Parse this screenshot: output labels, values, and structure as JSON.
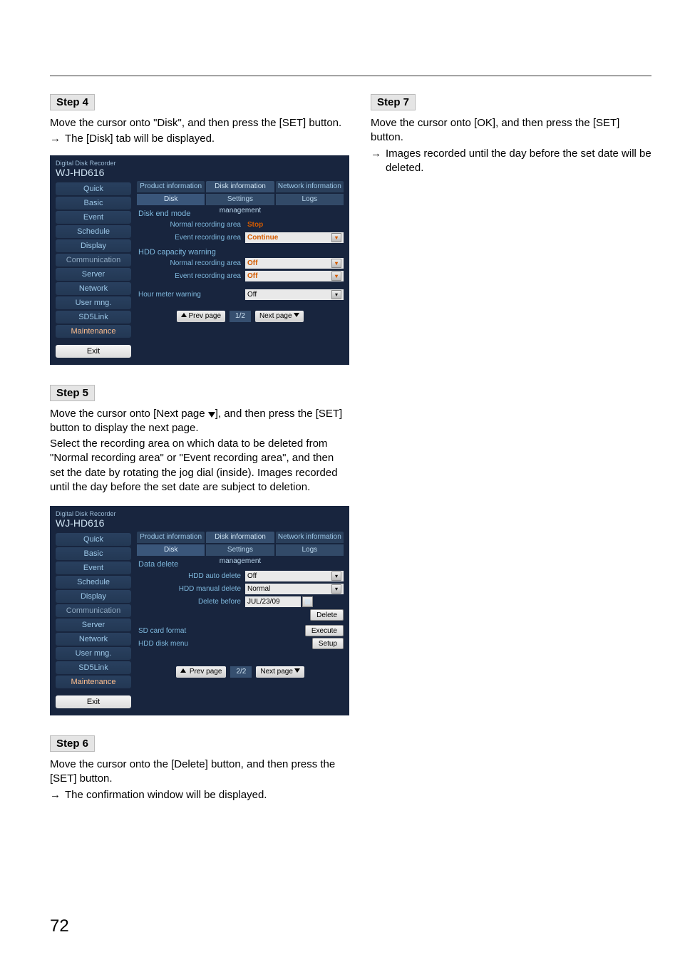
{
  "page_number": "72",
  "steps": {
    "s4": {
      "label": "Step 4",
      "text": "Move the cursor onto \"Disk\", and then press the [SET] button.",
      "arrow": "The [Disk] tab will be displayed."
    },
    "s5": {
      "label": "Step 5",
      "text1": "Move the cursor onto [Next page ",
      "text1b": "], and then press the [SET] button to display the next page.",
      "text2": "Select the recording area on which data to be deleted from \"Normal recording area\" or \"Event recording area\", and then set the date by rotating the jog dial (inside). Images recorded until the day before the set date are subject to deletion."
    },
    "s6": {
      "label": "Step 6",
      "text": "Move the cursor onto the [Delete] button, and then press the [SET] button.",
      "arrow": "The confirmation window will be displayed."
    },
    "s7": {
      "label": "Step 7",
      "text": "Move the cursor onto [OK], and then press the [SET] button.",
      "arrow": "Images recorded until the day before the set date will be deleted."
    }
  },
  "shared": {
    "product_line": "Digital Disk Recorder",
    "model": "WJ-HD616",
    "sidebar": [
      "Quick",
      "Basic",
      "Event",
      "Schedule",
      "Display",
      "Communication",
      "Server",
      "Network",
      "User mng.",
      "SD5Link",
      "Maintenance"
    ],
    "exit": "Exit",
    "top_tabs": [
      "Product information",
      "Disk information",
      "Network information"
    ],
    "sub_tabs": [
      "Disk",
      "Settings management",
      "Logs"
    ],
    "pager_prev": "Prev page",
    "pager_next": "Next page"
  },
  "panel1": {
    "section1": "Disk end mode",
    "r1_lbl": "Normal recording area",
    "r1_val": "Stop",
    "r2_lbl": "Event recording area",
    "r2_val": "Continue",
    "section2": "HDD capacity warning",
    "r3_lbl": "Normal recording area",
    "r3_val": "Off",
    "r4_lbl": "Event recording area",
    "r4_val": "Off",
    "r5_lbl": "Hour meter warning",
    "r5_val": "Off",
    "page": "1/2"
  },
  "panel2": {
    "section1": "Data delete",
    "r1_lbl": "HDD auto delete",
    "r1_val": "Off",
    "r2_lbl": "HDD manual delete",
    "r2_val": "Normal",
    "r3_lbl": "Delete before",
    "r3_val": "JUL/23/09",
    "delete_btn": "Delete",
    "r4_lbl": "SD card format",
    "r4_btn": "Execute",
    "r5_lbl": "HDD disk menu",
    "r5_btn": "Setup",
    "page": "2/2"
  }
}
